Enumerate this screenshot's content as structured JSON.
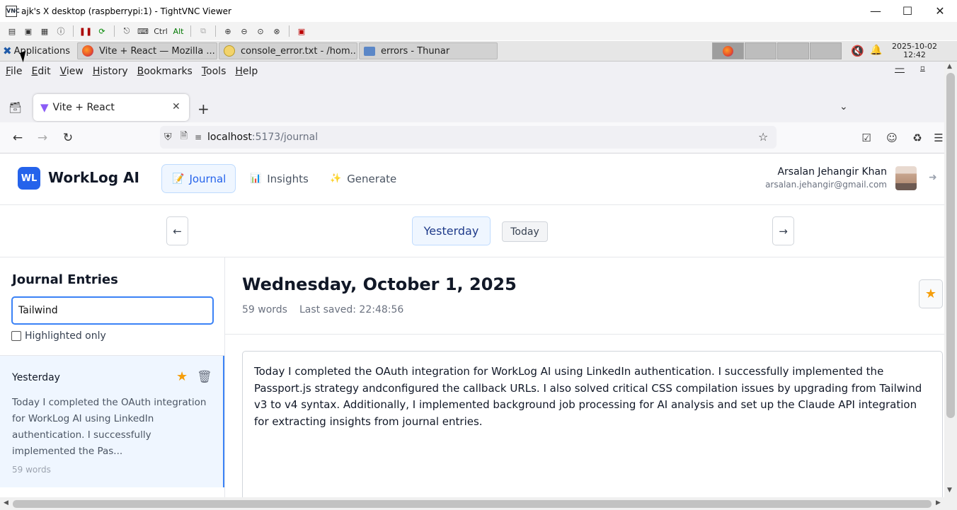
{
  "vnc": {
    "title": "ajk's X desktop (raspberrypi:1) - TightVNC Viewer",
    "logo_text": "VNC",
    "toolbar_text": {
      "ctrl": "Ctrl",
      "alt": "Alt"
    }
  },
  "panel": {
    "applications_label": "Applications",
    "tasks": [
      {
        "label": "Vite + React — Mozilla ..."
      },
      {
        "label": "console_error.txt - /hom..."
      },
      {
        "label": "errors - Thunar"
      }
    ],
    "date": "2025-10-02",
    "time": "12:42"
  },
  "firefox": {
    "menu": [
      "File",
      "Edit",
      "View",
      "History",
      "Bookmarks",
      "Tools",
      "Help"
    ],
    "tab_title": "Vite + React",
    "url_host": "localhost",
    "url_path": ":5173/journal"
  },
  "app": {
    "logo_text": "WL",
    "brand": "WorkLog AI",
    "nav": [
      {
        "icon": "📝",
        "label": "Journal",
        "active": true
      },
      {
        "icon": "📊",
        "label": "Insights",
        "active": false
      },
      {
        "icon": "✨",
        "label": "Generate",
        "active": false
      }
    ],
    "user": {
      "name": "Arsalan Jehangir Khan",
      "email": "arsalan.jehangir@gmail.com"
    },
    "datebar": {
      "prev": "←",
      "next": "→",
      "current": "Yesterday",
      "today": "Today"
    },
    "sidebar": {
      "title": "Journal Entries",
      "search_value": "Tailwind",
      "highlighted_only_label": "Highlighted only",
      "highlighted_only_checked": false,
      "entries": [
        {
          "label": "Yesterday",
          "preview": "Today I completed the OAuth integration for WorkLog AI using LinkedIn authentication. I successfully implemented the Pas...",
          "words": "59 words",
          "starred": true
        }
      ]
    },
    "entry": {
      "date_title": "Wednesday, October 1, 2025",
      "word_count": "59 words",
      "last_saved": "Last saved: 22:48:56",
      "body": "Today I completed the OAuth integration for WorkLog AI using LinkedIn authentication. I successfully implemented the Passport.js strategy andconfigured the callback URLs. I also solved critical CSS compilation issues by upgrading from Tailwind v3 to v4 syntax. Additionally, I implemented background job processing for AI analysis and set up the Claude API integration for extracting insights from journal entries.",
      "starred": true
    }
  },
  "colors": {
    "accent": "#2563eb",
    "star": "#f59e0b",
    "active_nav_bg": "#eff6ff",
    "selected_entry_bg": "#eff6ff"
  }
}
